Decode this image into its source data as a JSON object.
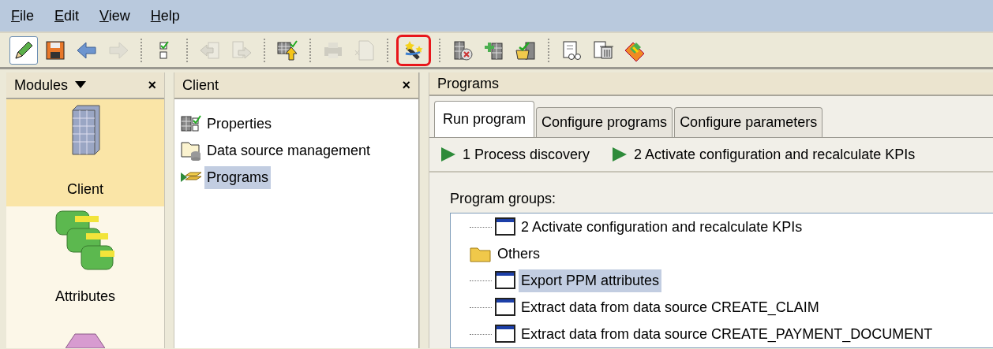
{
  "menu": [
    "File",
    "Edit",
    "View",
    "Help"
  ],
  "toolbar": [
    [
      {
        "pressed": true,
        "disabled": false
      },
      {
        "disabled": false
      },
      {
        "disabled": false
      },
      {
        "disabled": true
      }
    ],
    [
      {
        "disabled": false
      }
    ],
    [
      {
        "disabled": true
      },
      {
        "disabled": true
      }
    ],
    [
      {
        "disabled": false
      }
    ],
    [
      {
        "disabled": true
      },
      {
        "disabled": true
      }
    ],
    [
      {
        "disabled": false,
        "highlighted": true
      }
    ],
    [
      {
        "disabled": false
      },
      {
        "disabled": false
      },
      {
        "disabled": false
      }
    ],
    [
      {
        "disabled": false
      },
      {
        "disabled": false
      },
      {
        "disabled": false
      }
    ]
  ],
  "modules": {
    "title": "Modules",
    "close": "×",
    "items": [
      {
        "label": "Client",
        "selected": true
      },
      {
        "label": "Attributes",
        "selected": false
      },
      {
        "selected": false
      }
    ]
  },
  "client": {
    "title": "Client",
    "close": "×",
    "items": [
      {
        "label": "Properties",
        "selected": false
      },
      {
        "label": "Data source management",
        "selected": false
      },
      {
        "label": "Programs",
        "selected": true
      }
    ]
  },
  "programs": {
    "title": "Programs",
    "tabs": [
      {
        "label": "Run program",
        "selected": true
      },
      {
        "label": "Configure programs",
        "selected": false
      },
      {
        "label": "Configure parameters",
        "selected": false
      }
    ],
    "run_buttons": [
      "1 Process discovery",
      "2 Activate configuration and recalculate KPIs"
    ],
    "groups_label": "Program groups:",
    "tree": [
      {
        "kind": "program",
        "label": "2 Activate configuration and recalculate KPIs",
        "selected": false
      },
      {
        "kind": "folder",
        "label": "Others",
        "selected": false,
        "children": [
          {
            "kind": "program",
            "label": "Export PPM attributes",
            "selected": true
          },
          {
            "kind": "program",
            "label": "Extract data from data source CREATE_CLAIM",
            "selected": false
          },
          {
            "kind": "program",
            "label": "Extract data from data source CREATE_PAYMENT_DOCUMENT",
            "selected": false
          }
        ]
      }
    ]
  }
}
